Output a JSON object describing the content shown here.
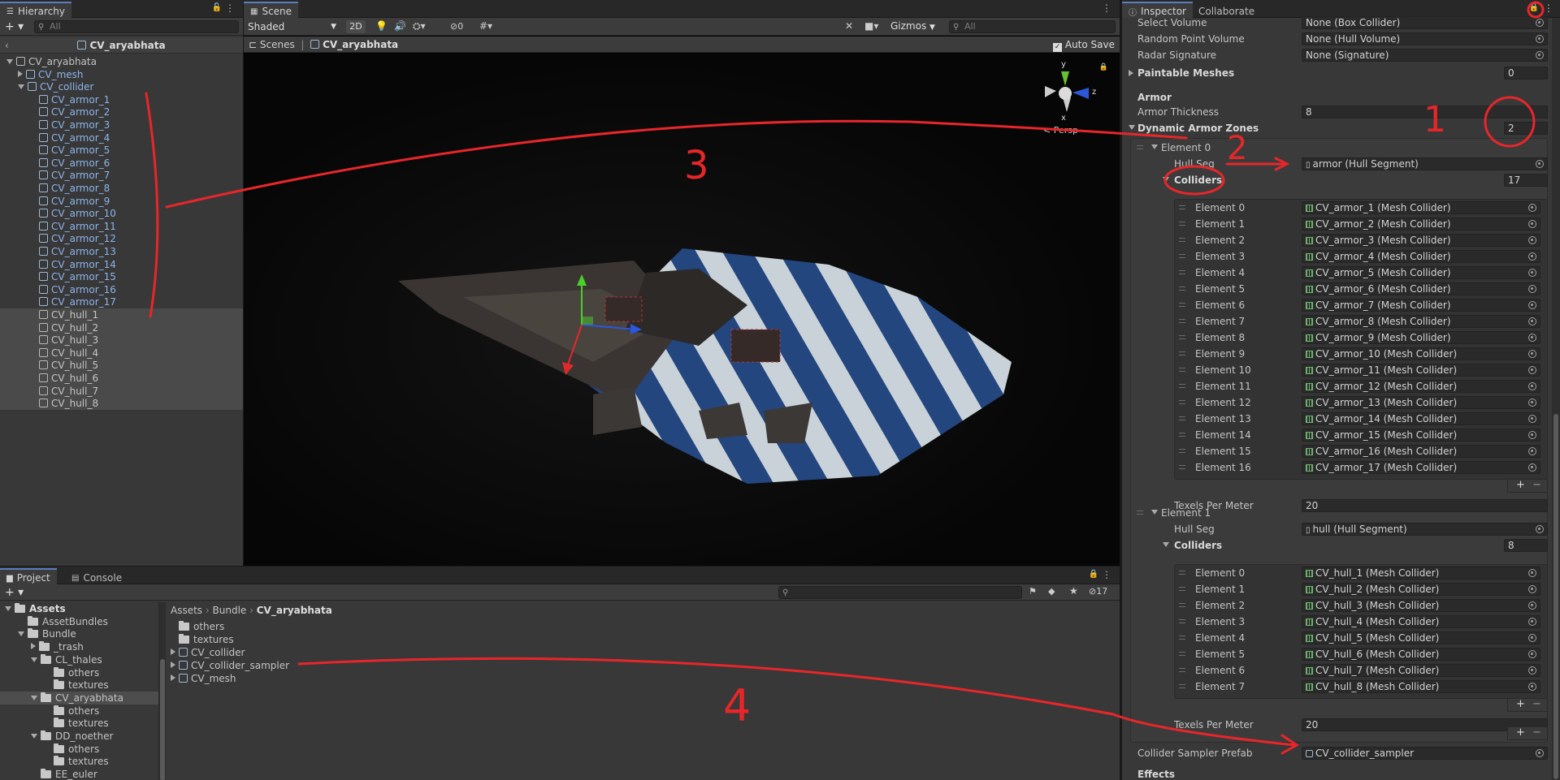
{
  "hierarchy": {
    "tab": "Hierarchy",
    "search_placeholder": "All",
    "header": "CV_aryabhata",
    "root": "CV_aryabhata",
    "mesh": "CV_mesh",
    "collider": "CV_collider",
    "armor": [
      "CV_armor_1",
      "CV_armor_2",
      "CV_armor_3",
      "CV_armor_4",
      "CV_armor_5",
      "CV_armor_6",
      "CV_armor_7",
      "CV_armor_8",
      "CV_armor_9",
      "CV_armor_10",
      "CV_armor_11",
      "CV_armor_12",
      "CV_armor_13",
      "CV_armor_14",
      "CV_armor_15",
      "CV_armor_16",
      "CV_armor_17"
    ],
    "hull": [
      "CV_hull_1",
      "CV_hull_2",
      "CV_hull_3",
      "CV_hull_4",
      "CV_hull_5",
      "CV_hull_6",
      "CV_hull_7",
      "CV_hull_8"
    ]
  },
  "scene": {
    "tab": "Scene",
    "shading": "Shaded",
    "mode_2d": "2D",
    "hidden_count": "0",
    "gizmos": "Gizmos",
    "search_placeholder": "All",
    "breadcrumb_root": "Scenes",
    "breadcrumb_current": "CV_aryabhata",
    "auto_save": "Auto Save",
    "auto_save_checked": true,
    "persp": "Persp",
    "axis_y": "y",
    "axis_z": "z",
    "axis_x": "x"
  },
  "project": {
    "tab": "Project",
    "console_tab": "Console",
    "badge_count": "17",
    "tree": [
      {
        "label": "Assets",
        "depth": 0,
        "expanded": true,
        "bold": true
      },
      {
        "label": "AssetBundles",
        "depth": 1
      },
      {
        "label": "Bundle",
        "depth": 1,
        "expanded": true
      },
      {
        "label": "_trash",
        "depth": 2,
        "collapsed": true
      },
      {
        "label": "CL_thales",
        "depth": 2,
        "expanded": true
      },
      {
        "label": "others",
        "depth": 3
      },
      {
        "label": "textures",
        "depth": 3
      },
      {
        "label": "CV_aryabhata",
        "depth": 2,
        "expanded": true,
        "selected": true
      },
      {
        "label": "others",
        "depth": 3
      },
      {
        "label": "textures",
        "depth": 3
      },
      {
        "label": "DD_noether",
        "depth": 2,
        "expanded": true
      },
      {
        "label": "others",
        "depth": 3
      },
      {
        "label": "textures",
        "depth": 3
      },
      {
        "label": "EE_euler",
        "depth": 2
      }
    ],
    "breadcrumb": [
      "Assets",
      "Bundle",
      "CV_aryabhata"
    ],
    "files": [
      {
        "label": "others",
        "kind": "folder"
      },
      {
        "label": "textures",
        "kind": "folder"
      },
      {
        "label": "CV_collider",
        "kind": "prefab"
      },
      {
        "label": "CV_collider_sampler",
        "kind": "prefab"
      },
      {
        "label": "CV_mesh",
        "kind": "prefab"
      }
    ]
  },
  "inspector": {
    "tab": "Inspector",
    "collaborate_tab": "Collaborate",
    "select_volume": {
      "label": "Select Volume",
      "value": "None (Box Collider)"
    },
    "random_point_volume": {
      "label": "Random Point Volume",
      "value": "None (Hull Volume)"
    },
    "radar_signature": {
      "label": "Radar Signature",
      "value": "None (Signature)"
    },
    "paintable_meshes": {
      "label": "Paintable Meshes",
      "value": "0"
    },
    "armor_header": "Armor",
    "armor_thickness": {
      "label": "Armor Thickness",
      "value": "8"
    },
    "dynamic_armor_zones": {
      "label": "Dynamic Armor Zones",
      "value": "2"
    },
    "element0": {
      "label": "Element 0",
      "hull_seg_label": "Hull Seg",
      "hull_seg_value": "armor (Hull Segment)",
      "colliders_label": "Colliders",
      "colliders_count": "17",
      "items": [
        {
          "label": "Element 0",
          "value": "CV_armor_1 (Mesh Collider)"
        },
        {
          "label": "Element 1",
          "value": "CV_armor_2 (Mesh Collider)"
        },
        {
          "label": "Element 2",
          "value": "CV_armor_3 (Mesh Collider)"
        },
        {
          "label": "Element 3",
          "value": "CV_armor_4 (Mesh Collider)"
        },
        {
          "label": "Element 4",
          "value": "CV_armor_5 (Mesh Collider)"
        },
        {
          "label": "Element 5",
          "value": "CV_armor_6 (Mesh Collider)"
        },
        {
          "label": "Element 6",
          "value": "CV_armor_7 (Mesh Collider)"
        },
        {
          "label": "Element 7",
          "value": "CV_armor_8 (Mesh Collider)"
        },
        {
          "label": "Element 8",
          "value": "CV_armor_9 (Mesh Collider)"
        },
        {
          "label": "Element 9",
          "value": "CV_armor_10 (Mesh Collider)"
        },
        {
          "label": "Element 10",
          "value": "CV_armor_11 (Mesh Collider)"
        },
        {
          "label": "Element 11",
          "value": "CV_armor_12 (Mesh Collider)"
        },
        {
          "label": "Element 12",
          "value": "CV_armor_13 (Mesh Collider)"
        },
        {
          "label": "Element 13",
          "value": "CV_armor_14 (Mesh Collider)"
        },
        {
          "label": "Element 14",
          "value": "CV_armor_15 (Mesh Collider)"
        },
        {
          "label": "Element 15",
          "value": "CV_armor_16 (Mesh Collider)"
        },
        {
          "label": "Element 16",
          "value": "CV_armor_17 (Mesh Collider)"
        }
      ],
      "texels_label": "Texels Per Meter",
      "texels_value": "20"
    },
    "element1": {
      "label": "Element 1",
      "hull_seg_label": "Hull Seg",
      "hull_seg_value": "hull (Hull Segment)",
      "colliders_label": "Colliders",
      "colliders_count": "8",
      "items": [
        {
          "label": "Element 0",
          "value": "CV_hull_1 (Mesh Collider)"
        },
        {
          "label": "Element 1",
          "value": "CV_hull_2 (Mesh Collider)"
        },
        {
          "label": "Element 2",
          "value": "CV_hull_3 (Mesh Collider)"
        },
        {
          "label": "Element 3",
          "value": "CV_hull_4 (Mesh Collider)"
        },
        {
          "label": "Element 4",
          "value": "CV_hull_5 (Mesh Collider)"
        },
        {
          "label": "Element 5",
          "value": "CV_hull_6 (Mesh Collider)"
        },
        {
          "label": "Element 6",
          "value": "CV_hull_7 (Mesh Collider)"
        },
        {
          "label": "Element 7",
          "value": "CV_hull_8 (Mesh Collider)"
        }
      ],
      "texels_label": "Texels Per Meter",
      "texels_value": "20"
    },
    "collider_sampler": {
      "label": "Collider Sampler Prefab",
      "value": "CV_collider_sampler"
    },
    "effects_header": "Effects"
  },
  "annotations": {
    "n1": "1",
    "n2": "2",
    "n3": "3",
    "n4": "4",
    "color": "#e8262a"
  },
  "colors": {
    "accent": "#5a7fbf",
    "selection": "#2c5d87",
    "prefab_text": "#8cb4ec",
    "annotation": "#e8262a"
  }
}
